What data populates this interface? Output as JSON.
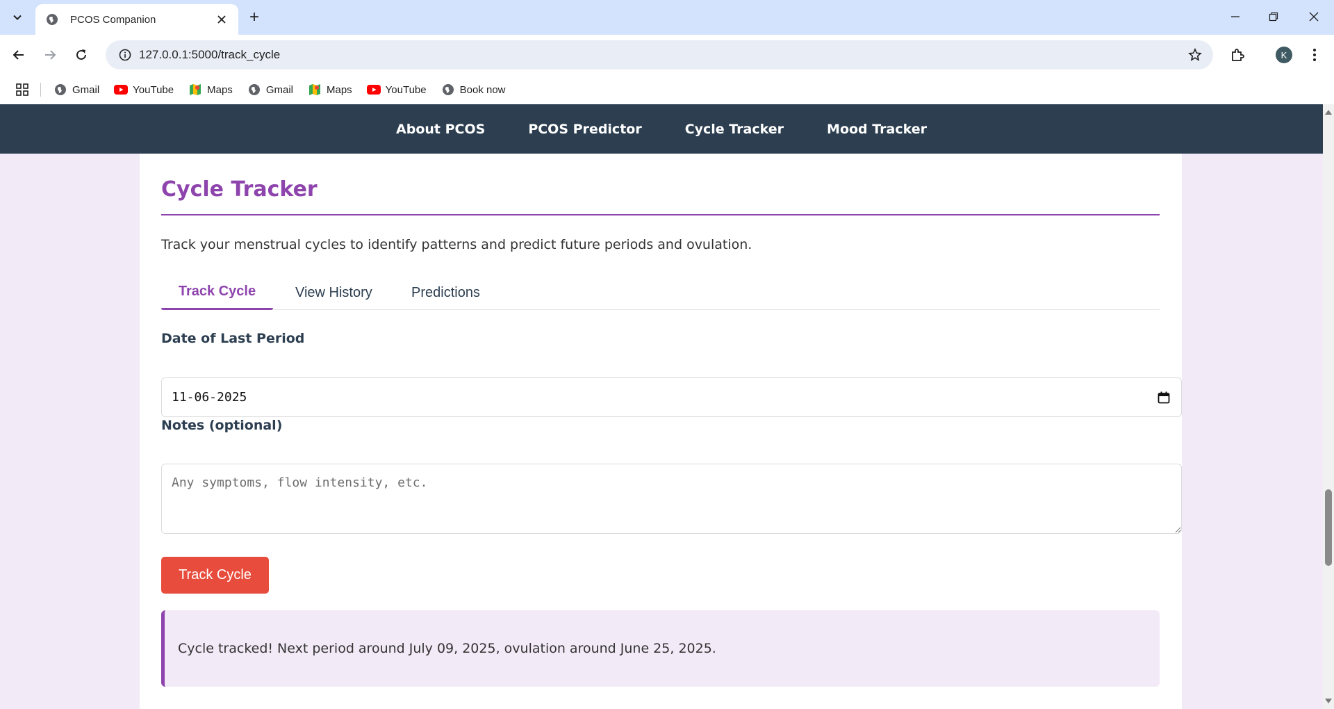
{
  "browser": {
    "tab_title": "PCOS Companion",
    "new_tab_symbol": "+",
    "url": "127.0.0.1:5000/track_cycle",
    "profile_initial": "K",
    "bookmarks": [
      {
        "label": "Gmail",
        "icon": "globe-icon"
      },
      {
        "label": "YouTube",
        "icon": "youtube-icon"
      },
      {
        "label": "Maps",
        "icon": "maps-icon"
      },
      {
        "label": "Gmail",
        "icon": "globe-icon"
      },
      {
        "label": "Maps",
        "icon": "maps-icon"
      },
      {
        "label": "YouTube",
        "icon": "youtube-icon"
      },
      {
        "label": "Book now",
        "icon": "globe-icon"
      }
    ]
  },
  "site_nav": {
    "items": [
      "About PCOS",
      "PCOS Predictor",
      "Cycle Tracker",
      "Mood Tracker"
    ]
  },
  "page": {
    "heading": "Cycle Tracker",
    "intro": "Track your menstrual cycles to identify patterns and predict future periods and ovulation.",
    "tabs": [
      {
        "label": "Track Cycle",
        "active": true
      },
      {
        "label": "View History",
        "active": false
      },
      {
        "label": "Predictions",
        "active": false
      }
    ],
    "form": {
      "date_label": "Date of Last Period",
      "date_value": "11-06-2025",
      "notes_label": "Notes (optional)",
      "notes_placeholder": "Any symptoms, flow intensity, etc.",
      "notes_value": "",
      "submit_label": "Track Cycle"
    },
    "alert": "Cycle tracked! Next period around July 09, 2025, ovulation around June 25, 2025."
  },
  "colors": {
    "accent": "#8e44ad",
    "nav_bg": "#2c3e50",
    "button": "#e74c3c",
    "page_bg": "#f3eaf7"
  }
}
